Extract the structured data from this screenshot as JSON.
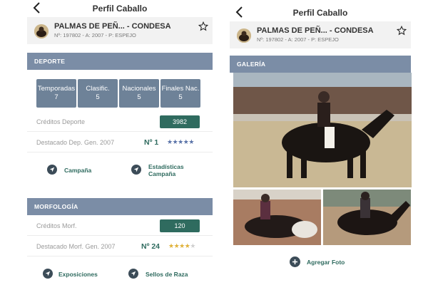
{
  "left": {
    "title": "Perfil Caballo",
    "horse": {
      "name": "PALMAS DE PEÑ... - CONDESA",
      "meta": "Nº: 197802 - A: 2007 - P: ESPEJO"
    },
    "deporte": {
      "header": "DEPORTE",
      "stats": [
        {
          "label": "Temporadas",
          "value": "7"
        },
        {
          "label": "Clasific.",
          "value": "5"
        },
        {
          "label": "Nacionales",
          "value": "5"
        },
        {
          "label": "Finales Nac.",
          "value": "5"
        }
      ],
      "creditos_label": "Créditos Deporte",
      "creditos_value": "3982",
      "destacado_label": "Destacado Dep. Gen. 2007",
      "destacado_rank": "Nº 1",
      "destacado_stars": 5,
      "links": {
        "campana": "Campaña",
        "estadisticas": "Estadísticas Campaña"
      }
    },
    "morfologia": {
      "header": "MORFOLOGÍA",
      "creditos_label": "Créditos Morf.",
      "creditos_value": "120",
      "destacado_label": "Destacado Morf. Gen. 2007",
      "destacado_rank": "Nº 24",
      "destacado_stars": 4,
      "links": {
        "exposiciones": "Exposiciones",
        "sellos": "Sellos de Raza"
      }
    }
  },
  "right": {
    "title": "Perfil Caballo",
    "horse": {
      "name": "PALMAS DE PEÑ... - CONDESA",
      "meta": "Nº: 197802 - A: 2007 - P: ESPEJO"
    },
    "gallery_header": "GALERÍA",
    "add_photo": "Agregar Foto"
  },
  "colors": {
    "accent_green": "#2f6b5f",
    "section_blue": "#7b8da6",
    "stat_box": "#6e8298",
    "star_blue": "#5a73a8",
    "star_gold": "#e0b23a"
  },
  "icons": [
    "back-arrow-icon",
    "star-outline-icon",
    "location-arrow-icon",
    "plus-icon"
  ]
}
